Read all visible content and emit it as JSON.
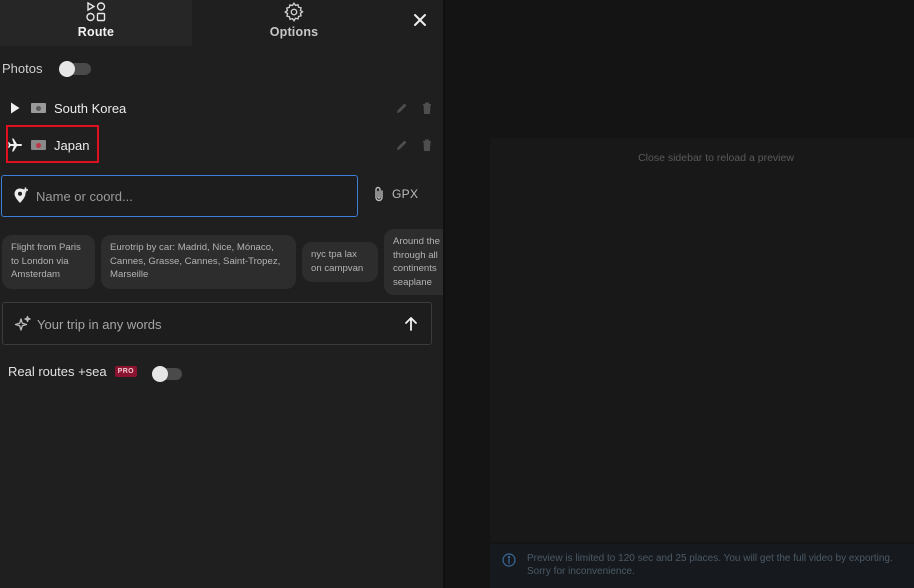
{
  "tabs": {
    "route": "Route",
    "options": "Options"
  },
  "photos": {
    "label": "Photos",
    "enabled": false
  },
  "route_items": [
    {
      "name": "South Korea",
      "lead_icon": "play-triangle-icon",
      "flag": "south-korea-flag"
    },
    {
      "name": "Japan",
      "lead_icon": "airplane-icon",
      "flag": "japan-flag"
    }
  ],
  "search": {
    "placeholder": "Name or coord...",
    "value": ""
  },
  "gpx_label": "GPX",
  "suggestions": [
    "Flight from Paris to London via Amsterdam",
    "Eurotrip by car: Madrid, Nice, Mónaco, Cannes, Grasse, Cannes, Saint-Tropez, Marseille",
    "nyc tpa lax on campvan",
    "Around the through all continents seaplane"
  ],
  "trip": {
    "placeholder": "Your trip in any words",
    "value": ""
  },
  "real_routes": {
    "label": "Real routes +sea",
    "badge": "PRO",
    "enabled": false
  },
  "preview": {
    "message": "Close sidebar to reload a preview",
    "info": "Preview is limited to 120 sec and 25 places. You will get the full video by exporting. Sorry for inconvenience."
  },
  "colors": {
    "highlight": "#e0101e",
    "focus_border": "#3d7fd6",
    "pro_badge": "#8a1430"
  }
}
